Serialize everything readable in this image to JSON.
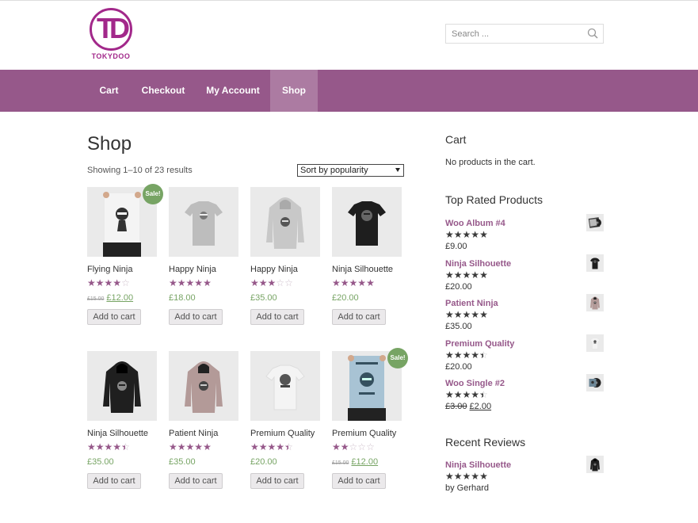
{
  "brand": {
    "name": "TOKYDOO",
    "letters": "TD",
    "accent": "#a2288a"
  },
  "search": {
    "placeholder": "Search ..."
  },
  "nav": {
    "color": "#96588a",
    "items": [
      {
        "label": "Cart"
      },
      {
        "label": "Checkout"
      },
      {
        "label": "My Account"
      },
      {
        "label": "Shop",
        "active": true
      }
    ]
  },
  "main": {
    "title": "Shop",
    "result_count": "Showing 1–10 of 23 results",
    "sort": {
      "selected": "Sort by popularity"
    },
    "add_to_cart_label": "Add to cart",
    "sale_badge": "Sale!",
    "products": [
      {
        "name": "Flying Ninja",
        "rating": 4,
        "regular_price": "£15.00",
        "price": "£12.00",
        "on_sale": true,
        "image": "poster-ninja-icon"
      },
      {
        "name": "Happy Ninja",
        "rating": 5,
        "price": "£18.00",
        "image": "grey-tshirt-icon"
      },
      {
        "name": "Happy Ninja",
        "rating": 3,
        "price": "£35.00",
        "image": "grey-hoodie-icon"
      },
      {
        "name": "Ninja Silhouette",
        "rating": 5,
        "price": "£20.00",
        "image": "black-tshirt-icon"
      },
      {
        "name": "Ninja Silhouette",
        "rating": 4.5,
        "price": "£35.00",
        "image": "black-hoodie-icon"
      },
      {
        "name": "Patient Ninja",
        "rating": 5,
        "price": "£35.00",
        "image": "pink-hoodie-icon"
      },
      {
        "name": "Premium Quality",
        "rating": 4.5,
        "price": "£20.00",
        "image": "white-tshirt-icon"
      },
      {
        "name": "Premium Quality",
        "rating": 2,
        "regular_price": "£15.00",
        "price": "£12.00",
        "on_sale": true,
        "image": "blue-poster-icon"
      }
    ]
  },
  "sidebar": {
    "cart": {
      "title": "Cart",
      "empty_text": "No products in the cart."
    },
    "top_rated": {
      "title": "Top Rated Products",
      "items": [
        {
          "name": "Woo Album #4",
          "rating": 5,
          "price": "£9.00",
          "thumb": "album-icon"
        },
        {
          "name": "Ninja Silhouette",
          "rating": 5,
          "price": "£20.00",
          "thumb": "black-tshirt-icon"
        },
        {
          "name": "Patient Ninja",
          "rating": 5,
          "price": "£35.00",
          "thumb": "pink-hoodie-icon"
        },
        {
          "name": "Premium Quality",
          "rating": 4.5,
          "price": "£20.00",
          "thumb": "white-tshirt-icon"
        },
        {
          "name": "Woo Single #2",
          "rating": 4.5,
          "regular_price": "£3.00",
          "price": "£2.00",
          "thumb": "single-icon"
        }
      ]
    },
    "recent_reviews": {
      "title": "Recent Reviews",
      "items": [
        {
          "name": "Ninja Silhouette",
          "rating": 5,
          "by": "by Gerhard",
          "thumb": "black-hoodie-icon"
        }
      ]
    }
  }
}
